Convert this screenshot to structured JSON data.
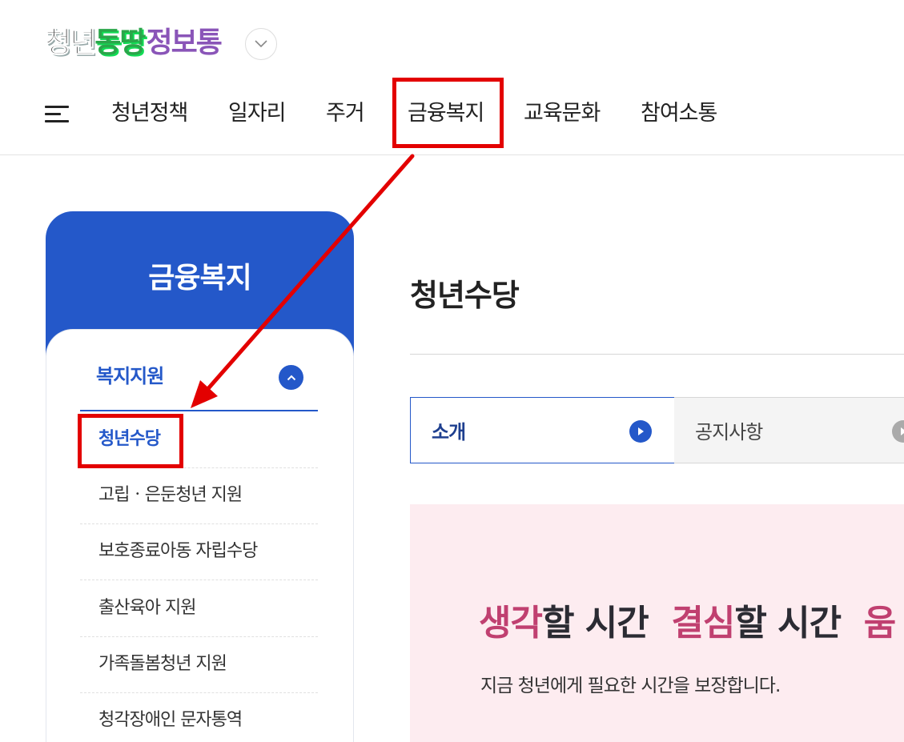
{
  "header": {
    "logo_parts": [
      "청년",
      "동땅",
      "정보통"
    ]
  },
  "gnb": {
    "items": [
      "청년정책",
      "일자리",
      "주거",
      "금융복지",
      "교육문화",
      "참여소통"
    ],
    "highlighted": "금융복지"
  },
  "sidebar": {
    "title": "금융복지",
    "category": "복지지원",
    "items": [
      "청년수당",
      "고립ㆍ은둔청년 지원",
      "보호종료아동 자립수당",
      "출산육아 지원",
      "가족돌봄청년 지원",
      "청각장애인 문자통역"
    ],
    "active_item": "청년수당"
  },
  "main": {
    "title": "청년수당",
    "tabs": [
      "소개",
      "공지사항"
    ],
    "active_tab": "소개",
    "banner": {
      "headline": [
        {
          "text": "생각",
          "hl": true
        },
        {
          "text": "할 시간  ",
          "hl": false
        },
        {
          "text": "결심",
          "hl": true
        },
        {
          "text": "할 시간  ",
          "hl": false
        },
        {
          "text": "움",
          "hl": true
        }
      ],
      "subtitle": "지금 청년에게 필요한 시간을 보장합니다."
    }
  },
  "colors": {
    "brand_blue": "#2458c9",
    "highlight_red": "#e30000",
    "banner_pink": "#fdecf0",
    "banner_accent": "#c04070"
  }
}
